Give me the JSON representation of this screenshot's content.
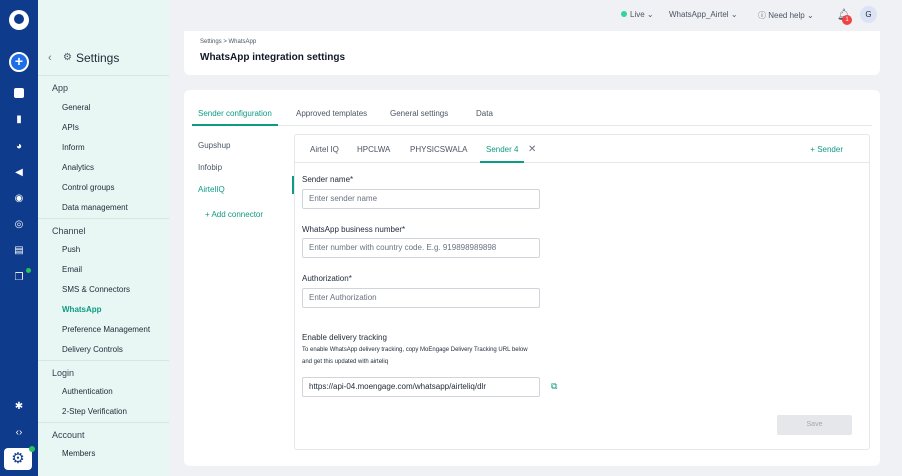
{
  "rail": {
    "icons": [
      "add-icon",
      "dashboard-icon",
      "bar-chart-icon",
      "pie-chart-icon",
      "megaphone-icon",
      "user-icon",
      "chat-icon",
      "document-icon",
      "layers-icon",
      "bug-icon",
      "code-icon",
      "settings-icon"
    ]
  },
  "sidebar": {
    "title": "Settings",
    "sections": [
      {
        "title": "App",
        "items": [
          "General",
          "APIs",
          "Inform",
          "Analytics",
          "Control groups",
          "Data management"
        ]
      },
      {
        "title": "Channel",
        "items": [
          "Push",
          "Email",
          "SMS & Connectors",
          "WhatsApp",
          "Preference Management",
          "Delivery Controls"
        ]
      },
      {
        "title": "Login",
        "items": [
          "Authentication",
          "2-Step Verification"
        ]
      },
      {
        "title": "Account",
        "items": [
          "Members"
        ]
      }
    ],
    "active_item": "WhatsApp"
  },
  "topbar": {
    "env": "Live",
    "workspace": "WhatsApp_Airtel",
    "help": "Need help",
    "notifications": "1",
    "avatar": "G"
  },
  "header": {
    "breadcrumb": "Settings > WhatsApp",
    "title": "WhatsApp integration settings"
  },
  "tabs": [
    "Sender configuration",
    "Approved templates",
    "General settings",
    "Data"
  ],
  "providers": [
    "Gupshup",
    "Infobip",
    "AirtelIQ"
  ],
  "add_connector": "+ Add connector",
  "sender_tabs": [
    "Airtel IQ",
    "HPCLWA",
    "PHYSICSWALA",
    "Sender 4"
  ],
  "add_sender": "+ Sender",
  "form": {
    "sender_name_label": "Sender name*",
    "sender_name_placeholder": "Enter sender name",
    "business_number_label": "WhatsApp business number*",
    "business_number_placeholder": "Enter number with country code. E.g. 919898989898",
    "authorization_label": "Authorization*",
    "authorization_placeholder": "Enter Authorization",
    "tracking_label": "Enable delivery tracking",
    "tracking_help_1": "To enable WhatsApp delivery tracking, copy MoEngage Delivery Tracking URL below",
    "tracking_help_2": "and get this updated with airteliq",
    "tracking_url": "https://api-04.moengage.com/whatsapp/airteliq/dlr",
    "save": "Save"
  },
  "colors": {
    "accent": "#0e9a83",
    "rail": "#0f3b8c",
    "sidebar_bg": "#e8f7f4"
  }
}
